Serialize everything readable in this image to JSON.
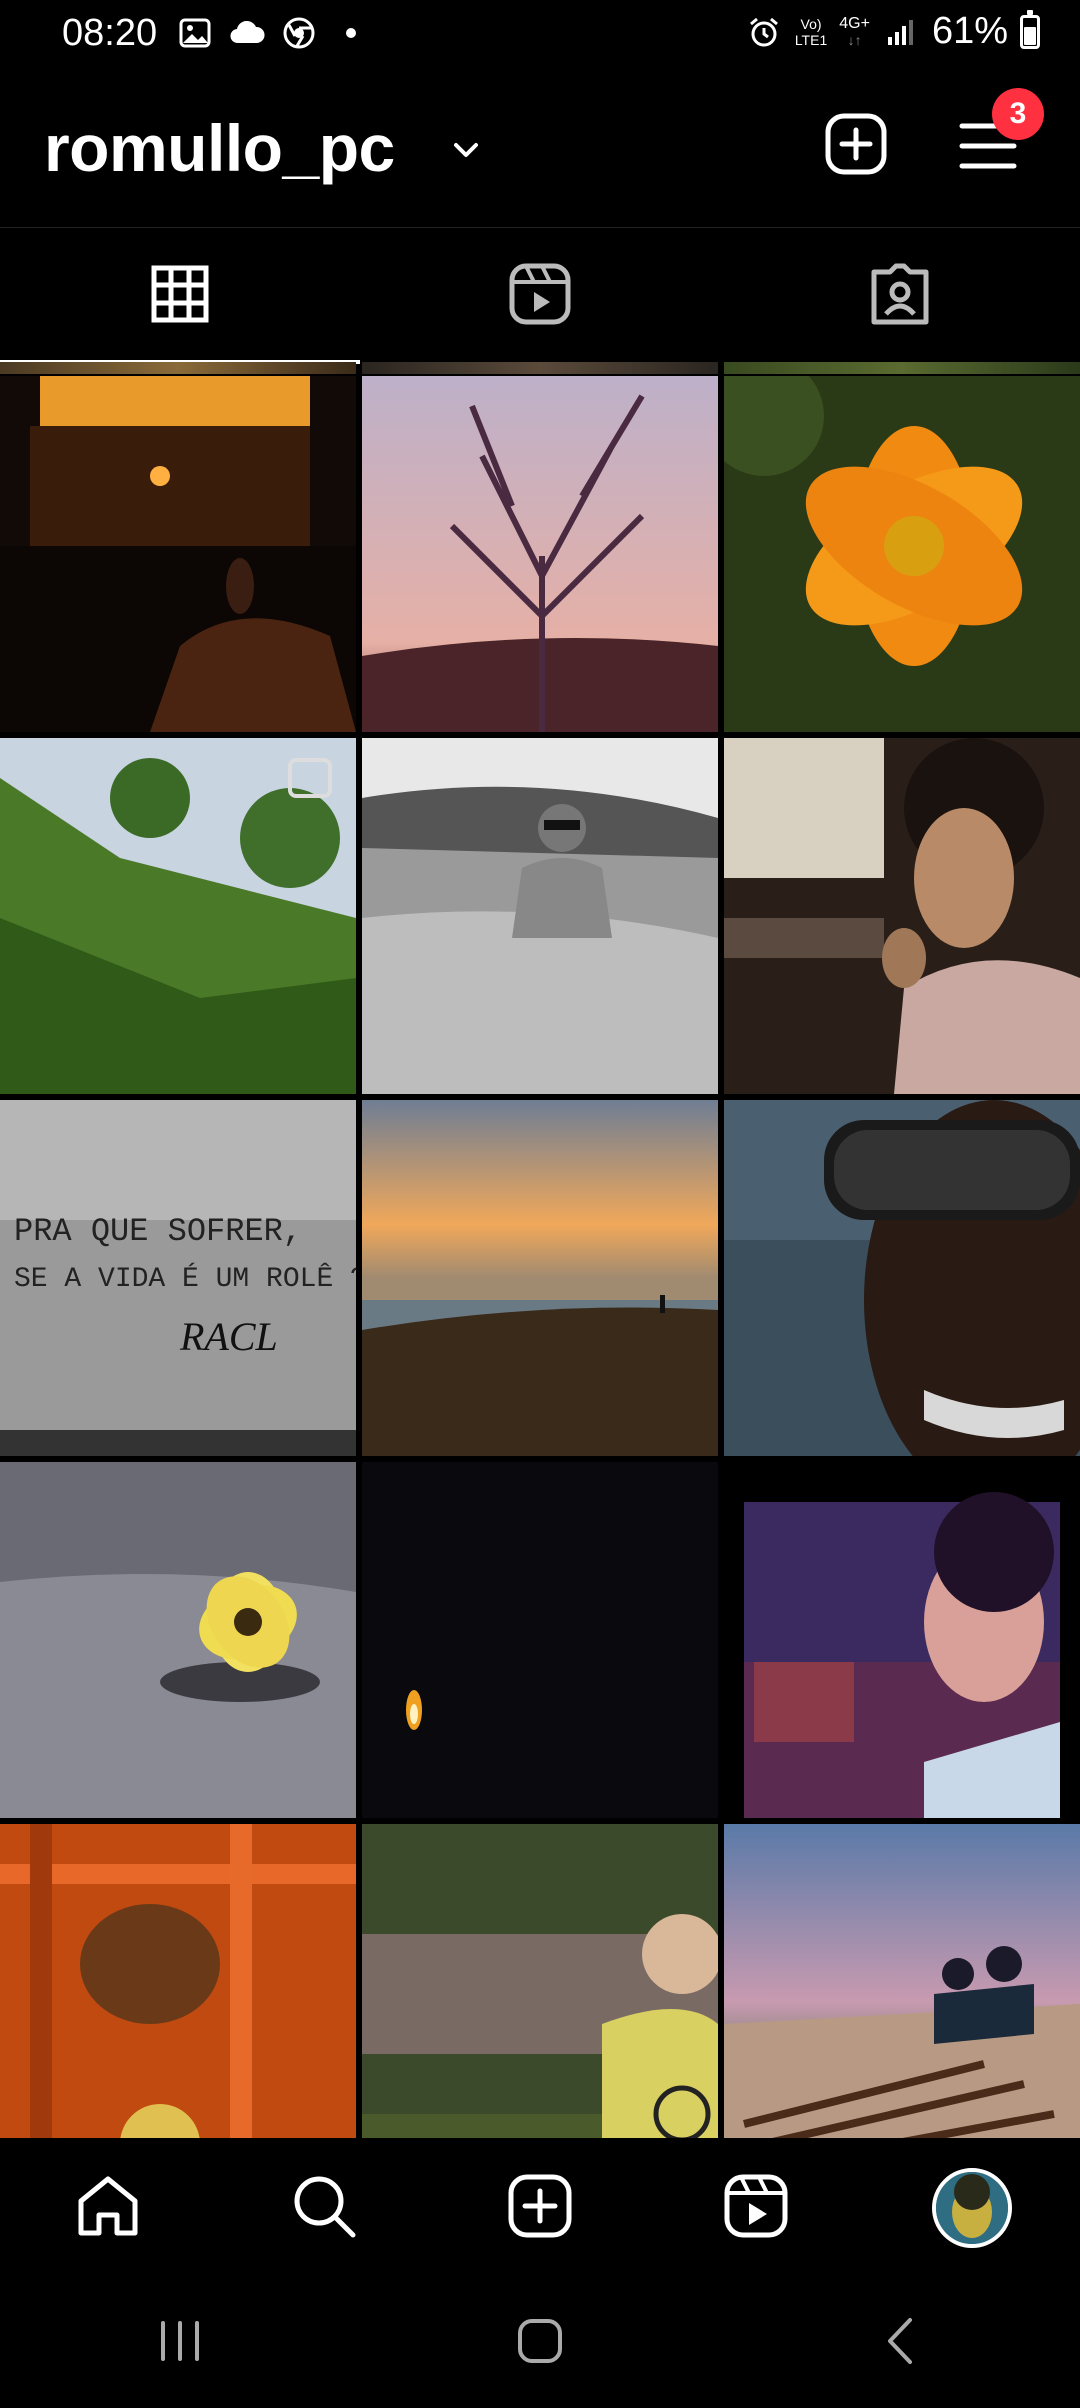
{
  "status_bar": {
    "time": "08:20",
    "network_top": "Vo)",
    "network_bottom": "LTE1",
    "network_gen": "4G+",
    "battery_percent": "61%",
    "battery_level": 0.61,
    "left_icons": [
      "gallery-icon",
      "cloud-icon",
      "chrome-icon",
      "dot-icon"
    ],
    "right_icons": [
      "alarm-icon",
      "signal-icon",
      "battery-icon"
    ]
  },
  "header": {
    "username": "romullo_pc",
    "notification_count": "3"
  },
  "tabs": [
    {
      "name": "grid",
      "icon": "grid-icon",
      "active": true
    },
    {
      "name": "reels",
      "icon": "reels-icon",
      "active": false
    },
    {
      "name": "tagged",
      "icon": "tagged-icon",
      "active": false
    }
  ],
  "grid": {
    "cells": [
      "Warm-lit window at night with feet in foreground",
      "Bare tree silhouette at sunset",
      "Orange cosmos flower",
      "Grassy hillside with trees",
      "Black and white man in water",
      "Man in profile with hand on chin",
      "Graffiti wall",
      "Beach at sunset with person walking",
      "Close-up man with diving goggles",
      "Yellow flower floating on water",
      "Candle flame in darkness",
      "Stylized portrait of man in profile",
      "Dog behind orange chair",
      "Illustrated man with peace sign shirt",
      "Two people on beach with driftwood"
    ],
    "wall_text_line1": "PRA QUE SOFRER,",
    "wall_text_line2": "SE A VIDA É UM ROLÊ ?",
    "wall_signature": "RACL"
  },
  "bottom_nav": [
    {
      "name": "home",
      "icon": "home-icon"
    },
    {
      "name": "search",
      "icon": "search-icon"
    },
    {
      "name": "create",
      "icon": "create-icon"
    },
    {
      "name": "reels",
      "icon": "reels-icon"
    },
    {
      "name": "profile",
      "icon": "profile-avatar"
    }
  ],
  "colors": {
    "background": "#000000",
    "text": "#ffffff",
    "badge": "#ff3040"
  }
}
